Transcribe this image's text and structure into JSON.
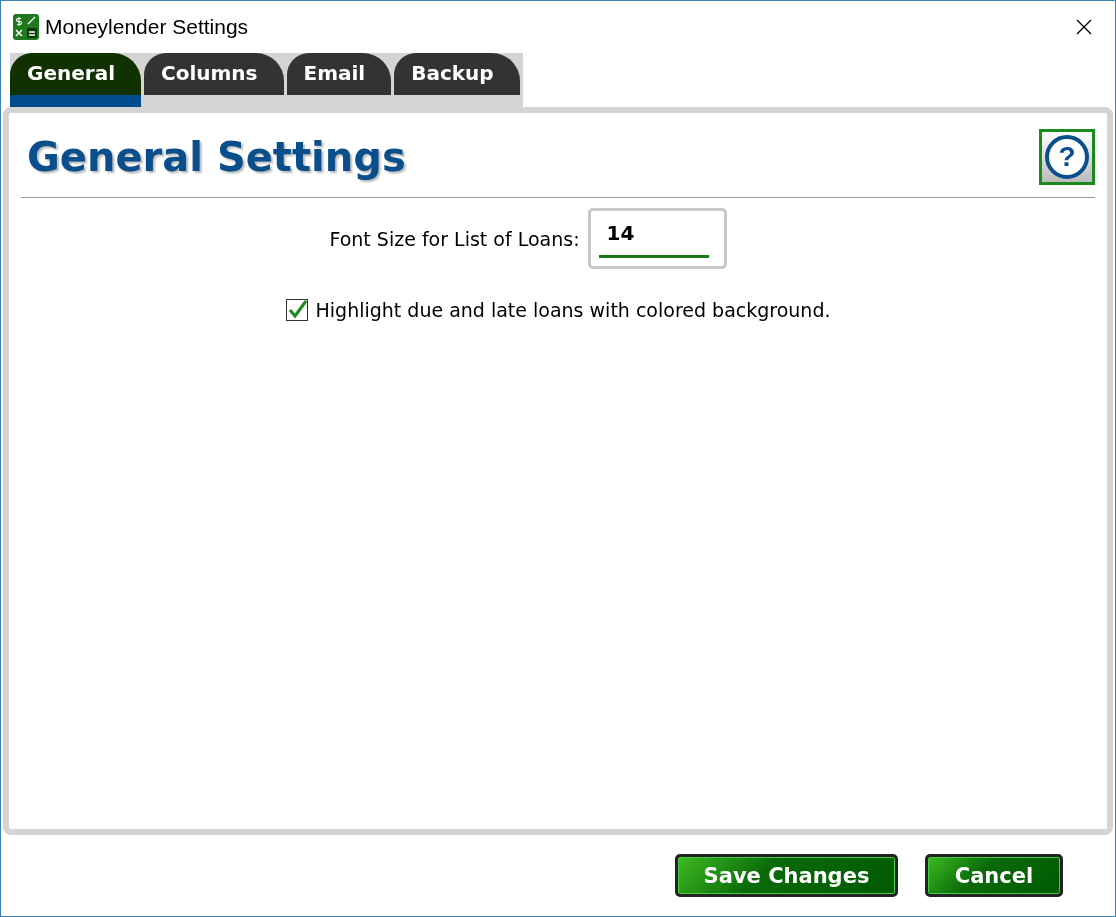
{
  "window": {
    "title": "Moneylender Settings"
  },
  "tabs": [
    {
      "label": "General",
      "selected": true
    },
    {
      "label": "Columns",
      "selected": false
    },
    {
      "label": "Email",
      "selected": false
    },
    {
      "label": "Backup",
      "selected": false
    }
  ],
  "heading": "General Settings",
  "help_button": {
    "label": "?"
  },
  "font_size": {
    "label": "Font Size for List of Loans:",
    "value": "14"
  },
  "highlight_option": {
    "label": "Highlight due and late loans with colored background.",
    "checked": true
  },
  "buttons": [
    {
      "label": "Save Changes"
    },
    {
      "label": "Cancel"
    }
  ]
}
